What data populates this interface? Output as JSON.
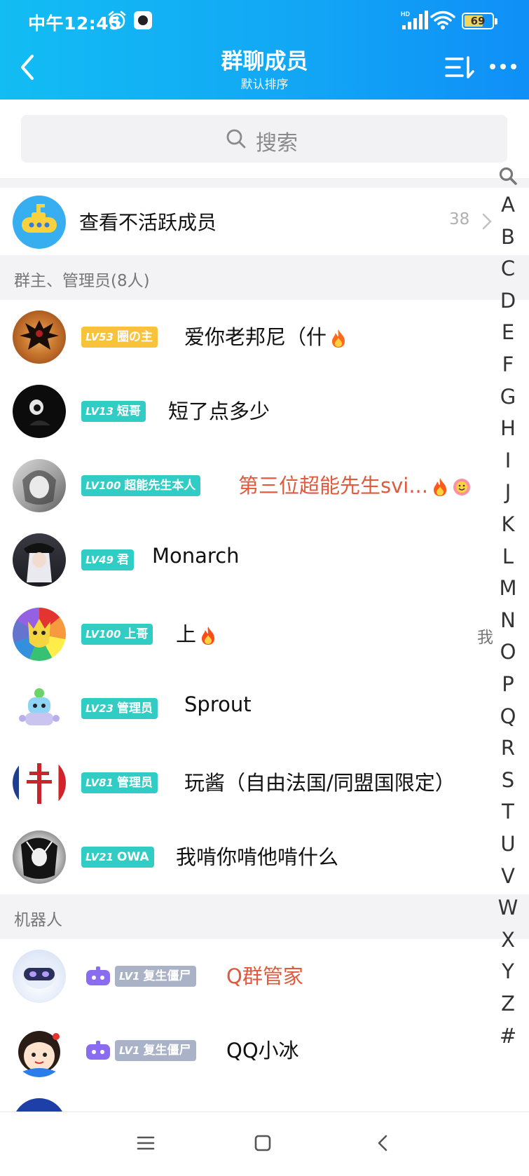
{
  "status_bar": {
    "time": "中午12:45",
    "battery": "69"
  },
  "header": {
    "title": "群聊成员",
    "subtitle": "默认排序"
  },
  "search": {
    "placeholder": "搜索"
  },
  "inactive": {
    "label": "查看不活跃成员",
    "count": "38"
  },
  "sections": {
    "admins": "群主、管理员(8人)",
    "robots": "机器人"
  },
  "members": [
    {
      "level": "LV53",
      "title": "圈の主",
      "name": "爱你老邦尼（什",
      "badge_color": "#f8c23b"
    },
    {
      "level": "LV13",
      "title": "短哥",
      "name": "短了点多少",
      "badge_color": "#31ccc4"
    },
    {
      "level": "LV100",
      "title": "超能先生本人",
      "name": "第三位超能先生svi...",
      "badge_color": "#31ccc4",
      "name_color": "#e05a3e"
    },
    {
      "level": "LV49",
      "title": "君",
      "name": "Monarch",
      "badge_color": "#31ccc4"
    },
    {
      "level": "LV100",
      "title": "上哥",
      "name": "上",
      "badge_color": "#31ccc4",
      "tag": "我"
    },
    {
      "level": "LV23",
      "title": "管理员",
      "name": "Sprout",
      "badge_color": "#31ccc4"
    },
    {
      "level": "LV81",
      "title": "管理员",
      "name": "玩酱（自由法国/同盟国限定）",
      "badge_color": "#31ccc4"
    },
    {
      "level": "LV21",
      "title": "OWA",
      "name": "我啃你啃他啃什么",
      "badge_color": "#31ccc4"
    }
  ],
  "robots": [
    {
      "level": "LV1",
      "title": "复生僵尸",
      "name": "Q群管家",
      "name_color": "#e05a3e"
    },
    {
      "level": "LV1",
      "title": "复生僵尸",
      "name": "QQ小冰"
    }
  ],
  "alphabet": [
    "A",
    "B",
    "C",
    "D",
    "E",
    "F",
    "G",
    "H",
    "I",
    "J",
    "K",
    "L",
    "M",
    "N",
    "O",
    "P",
    "Q",
    "R",
    "S",
    "T",
    "U",
    "V",
    "W",
    "X",
    "Y",
    "Z",
    "#"
  ],
  "colors": {
    "header": "#12a7f5",
    "accent_red": "#e05a3e",
    "badge_teal": "#31ccc4",
    "badge_gold": "#f8c23b"
  },
  "icons": [
    "back-arrow-icon",
    "sort-icon",
    "more-icon",
    "search-icon",
    "chevron-right-icon",
    "robot-icon",
    "fire-icon",
    "smile-icon"
  ]
}
